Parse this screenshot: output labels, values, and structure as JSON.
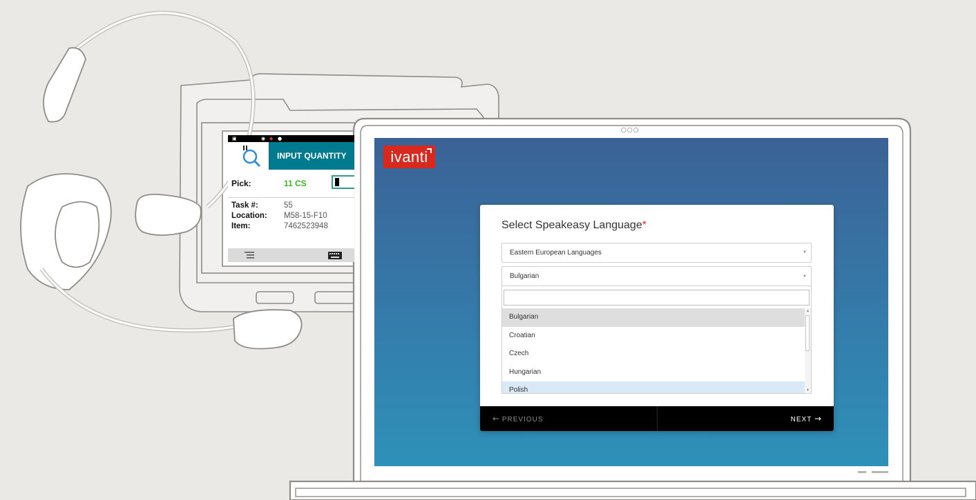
{
  "device": {
    "title": "INPUT QUANTITY",
    "pick_label": "Pick:",
    "pick_value": "11 CS",
    "rows": [
      {
        "label": "Task #:",
        "value": "55"
      },
      {
        "label": "Location:",
        "value": "M58-15-F10"
      },
      {
        "label": "Item:",
        "value": "7462523948"
      }
    ]
  },
  "laptop": {
    "camera": "○○○",
    "logo": "ivanti"
  },
  "dialog": {
    "title": "Select Speakeasy Language",
    "required_marker": "*",
    "region_select": {
      "value": "Eastern European Languages"
    },
    "language_select": {
      "value": "Bulgarian"
    },
    "search_value": "",
    "options": [
      "Bulgarian",
      "Croatian",
      "Czech",
      "Hungarian",
      "Polish"
    ],
    "selected_option": "Bulgarian",
    "hovered_option": "Polish",
    "previous_label": "PREVIOUS",
    "next_label": "NEXT"
  },
  "colors": {
    "brand_red": "#d8291e",
    "device_header": "#007a8f",
    "pick_value_green": "#3cb521",
    "required_red": "#e0312b",
    "hover_blue": "#d9e9f8"
  }
}
